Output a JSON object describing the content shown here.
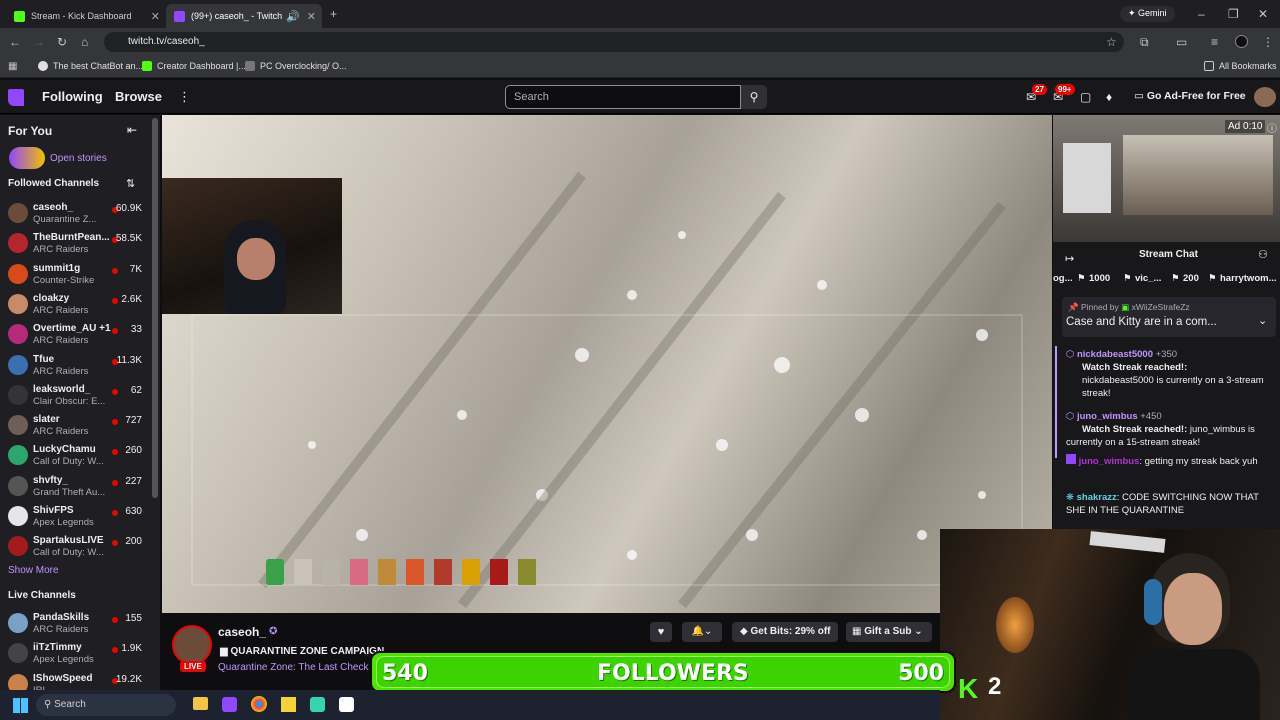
{
  "browser": {
    "tabs": [
      {
        "title": "Stream - Kick Dashboard",
        "color": "#53fc18"
      },
      {
        "title": "(99+) caseoh_ - Twitch",
        "color": "#9146ff"
      }
    ],
    "gemini": "Gemini",
    "url": "twitch.tv/caseoh_",
    "bookmarks": [
      "The best ChatBot an...",
      "Creator Dashboard |...",
      "PC Overclocking/ O..."
    ],
    "all_bookmarks": "All Bookmarks"
  },
  "twitch_nav": {
    "following": "Following",
    "browse": "Browse",
    "search_placeholder": "Search",
    "badge_inbox": "27",
    "badge_notif": "99+",
    "ad_free": "Go Ad-Free for Free"
  },
  "sidebar": {
    "for_you": "For You",
    "open_stories": "Open stories",
    "followed": "Followed Channels",
    "followed_channels": [
      {
        "name": "caseoh_",
        "game": "Quarantine Z...",
        "viewers": "60.9K",
        "color": "#6b4c3b"
      },
      {
        "name": "TheBurntPean...",
        "game": "ARC Raiders",
        "viewers": "58.5K",
        "color": "#b3262d"
      },
      {
        "name": "summit1g",
        "game": "Counter-Strike",
        "viewers": "7K",
        "color": "#d94a1a"
      },
      {
        "name": "cloakzy",
        "game": "ARC Raiders",
        "viewers": "2.6K",
        "color": "#c98a6a"
      },
      {
        "name": "Overtime_AU +1",
        "game": "ARC Raiders",
        "viewers": "33",
        "color": "#b52b7a"
      },
      {
        "name": "Tfue",
        "game": "ARC Raiders",
        "viewers": "11.3K",
        "color": "#3a6fb2"
      },
      {
        "name": "leaksworld_",
        "game": "Clair Obscur: E...",
        "viewers": "62",
        "color": "#333338"
      },
      {
        "name": "slater",
        "game": "ARC Raiders",
        "viewers": "727",
        "color": "#6e5e55"
      },
      {
        "name": "LuckyChamu",
        "game": "Call of Duty: W...",
        "viewers": "260",
        "color": "#2fa56e"
      },
      {
        "name": "shvfty_",
        "game": "Grand Theft Au...",
        "viewers": "227",
        "color": "#555"
      },
      {
        "name": "ShivFPS",
        "game": "Apex Legends",
        "viewers": "630",
        "color": "#e6e6e6"
      },
      {
        "name": "SpartakusLIVE",
        "game": "Call of Duty: W...",
        "viewers": "200",
        "color": "#a31b1b"
      }
    ],
    "show_more": "Show More",
    "live": "Live Channels",
    "live_channels": [
      {
        "name": "PandaSkills",
        "game": "ARC Raiders",
        "viewers": "155",
        "color": "#7aa0c8"
      },
      {
        "name": "iiTzTimmy",
        "game": "Apex Legends",
        "viewers": "1.9K",
        "color": "#444"
      },
      {
        "name": "IShowSpeed",
        "game": "IRL",
        "viewers": "19.2K",
        "color": "#c9824b"
      }
    ]
  },
  "stream": {
    "channel": "caseoh_",
    "live": "LIVE",
    "title": "QUARANTINE ZONE CAMPAIGN",
    "game": "Quarantine Zone: The Last Check",
    "get_bits": "Get Bits: 29% off",
    "gift_sub": "Gift a Sub"
  },
  "mini_player": {
    "ad": "Ad 0:10"
  },
  "chat": {
    "header": "Stream Chat",
    "leaderboard": [
      {
        "name": "og...",
        "points": ""
      },
      {
        "name": "",
        "points": "1000"
      },
      {
        "name": "vic_...",
        "points": "200"
      },
      {
        "name": "harrytwom...",
        "points": ""
      }
    ],
    "pinned_by": "Pinned by",
    "pinned_user": "xWiiZeStrafeZz",
    "pinned_text": "Case and Kitty are in a com...",
    "messages": [
      {
        "user": "nickdabeast5000",
        "pts": "+350",
        "bold": "Watch Streak reached!:",
        "text": "nickdabeast5000 is currently on a 3-stream streak!"
      },
      {
        "user": "juno_wimbus",
        "pts": "+450",
        "bold": "Watch Streak reached!:",
        "text": "juno_wimbus is currently on a 15-stream streak!"
      },
      {
        "user": "juno_wimbus",
        "text": ": getting my streak back yuh"
      },
      {
        "user": "shakrazz",
        "text": ": CODE SWITCHING NOW THAT SHE IN THE QUARANTINE"
      }
    ]
  },
  "overlay": {
    "followers_label": "FOLLOWERS",
    "current": "540",
    "goal": "500",
    "kick_count": "2"
  },
  "taskbar": {
    "search": "Search"
  }
}
